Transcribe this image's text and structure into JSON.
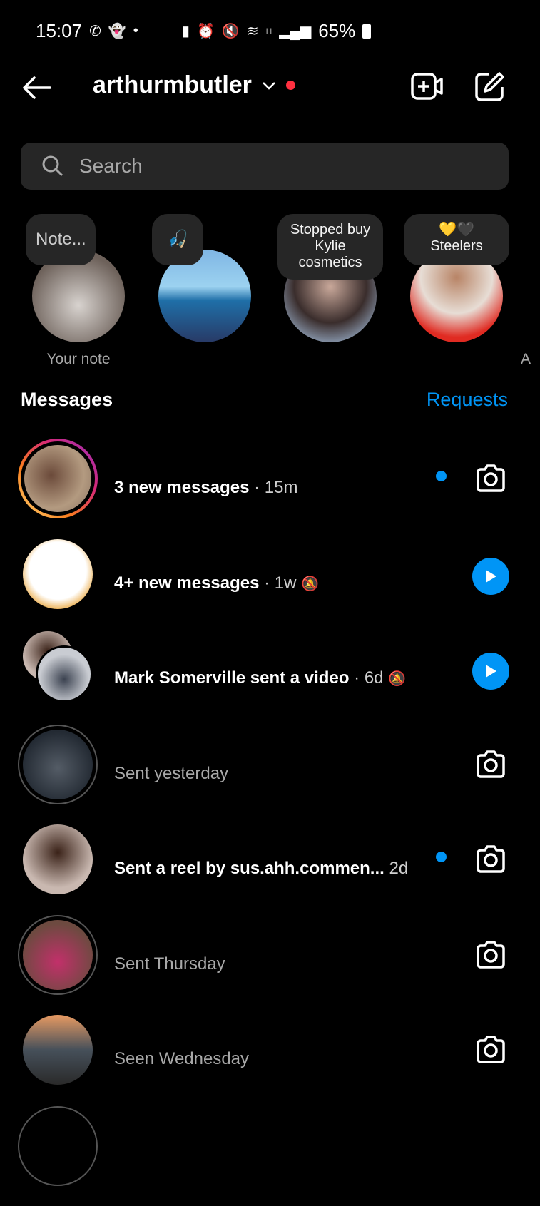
{
  "status_bar": {
    "time": "15:07",
    "battery": "65%",
    "network": "H"
  },
  "header": {
    "username": "arthurmbutler"
  },
  "search": {
    "placeholder": "Search"
  },
  "notes": [
    {
      "note": "Note...",
      "label": "Your note"
    },
    {
      "note": "🎣",
      "label": ""
    },
    {
      "note": "Stopped buy Kylie cosmetics",
      "label": ""
    },
    {
      "note": "💛🖤 Steelers",
      "label": ""
    }
  ],
  "edge_label": "A",
  "section": {
    "title": "Messages",
    "requests": "Requests"
  },
  "messages": [
    {
      "text": "3 new messages",
      "time": " · 15m",
      "unread": true,
      "action": "camera",
      "muted": false
    },
    {
      "text": "4+ new messages",
      "time": " · 1w",
      "unread": true,
      "action": "play",
      "muted": true
    },
    {
      "text": "Mark Somerville sent a video",
      "time": " · 6d",
      "unread": true,
      "action": "play",
      "muted": true
    },
    {
      "text": "Sent yesterday",
      "time": "",
      "unread": false,
      "action": "camera",
      "muted": false
    },
    {
      "text": "Sent a reel by sus.ahh.commen...",
      "time": "  2d",
      "unread": true,
      "action": "camera",
      "muted": false
    },
    {
      "text": "Sent Thursday",
      "time": "",
      "unread": false,
      "action": "camera",
      "muted": false
    },
    {
      "text": "Seen Wednesday",
      "time": "",
      "unread": false,
      "action": "camera",
      "muted": false
    }
  ]
}
